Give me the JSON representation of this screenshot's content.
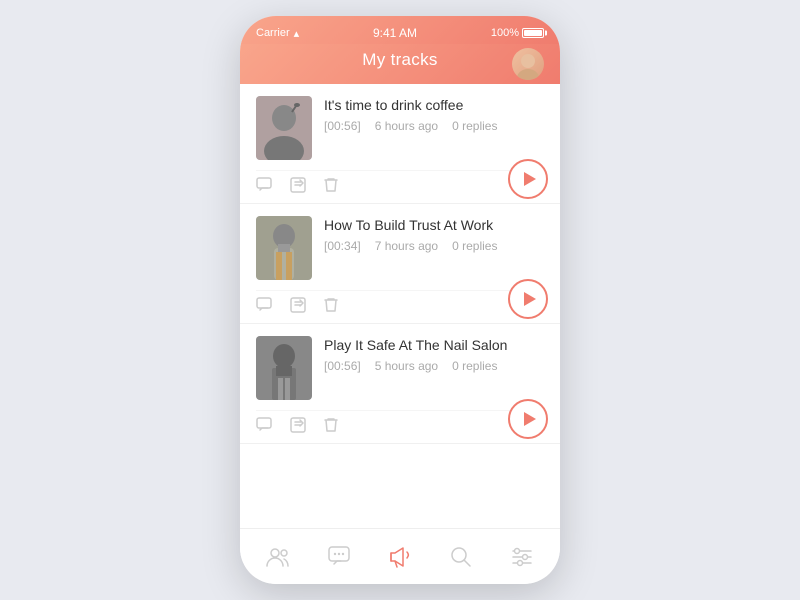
{
  "statusBar": {
    "carrier": "Carrier",
    "wifi": "wifi",
    "time": "9:41 AM",
    "battery": "100%"
  },
  "header": {
    "title": "My tracks"
  },
  "tracks": [
    {
      "id": 1,
      "title": "It's time to drink coffee",
      "duration": "[00:56]",
      "timeAgo": "6 hours ago",
      "replies": "0 replies"
    },
    {
      "id": 2,
      "title": "How To Build Trust At Work",
      "duration": "[00:34]",
      "timeAgo": "7 hours ago",
      "replies": "0 replies"
    },
    {
      "id": 3,
      "title": "Play It Safe At The Nail Salon",
      "duration": "[00:56]",
      "timeAgo": "5 hours ago",
      "replies": "0 replies"
    }
  ],
  "bottomNav": {
    "items": [
      "people",
      "chat",
      "megaphone",
      "search",
      "equalizer"
    ]
  },
  "colors": {
    "accent": "#f07c6e",
    "accentLight": "#f9a58b"
  }
}
